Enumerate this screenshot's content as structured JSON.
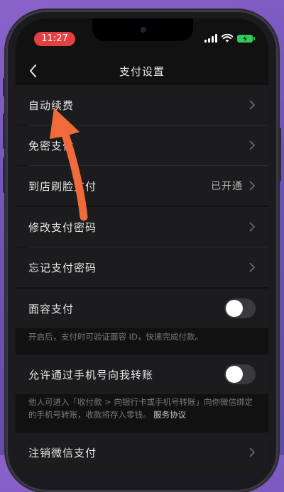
{
  "status_bar": {
    "time": "11:27"
  },
  "nav": {
    "title": "支付设置"
  },
  "rows": [
    {
      "label": "自动续费"
    },
    {
      "label": "免密支付"
    },
    {
      "label": "到店刷脸支付",
      "value": "已开通"
    },
    {
      "label": "修改支付密码"
    },
    {
      "label": "忘记支付密码"
    },
    {
      "label": "面容支付",
      "toggle": false
    },
    {
      "label": "允许通过手机号向我转账",
      "toggle": false
    },
    {
      "label": "注销微信支付"
    }
  ],
  "notes": {
    "face_pay": "开启后，支付时可验证面容 ID，快速完成付款。",
    "phone_transfer": "他人可进入「收付款 > 向银行卡或手机号转账」向你微信绑定的手机号转账，收款将存入零钱。",
    "phone_transfer_link": "服务协议"
  },
  "colors": {
    "background": "#111111",
    "row_bg": "#1c1c1e",
    "time_pill": "#e54040",
    "battery": "#34c759",
    "annotation_arrow": "#f06a3a"
  }
}
